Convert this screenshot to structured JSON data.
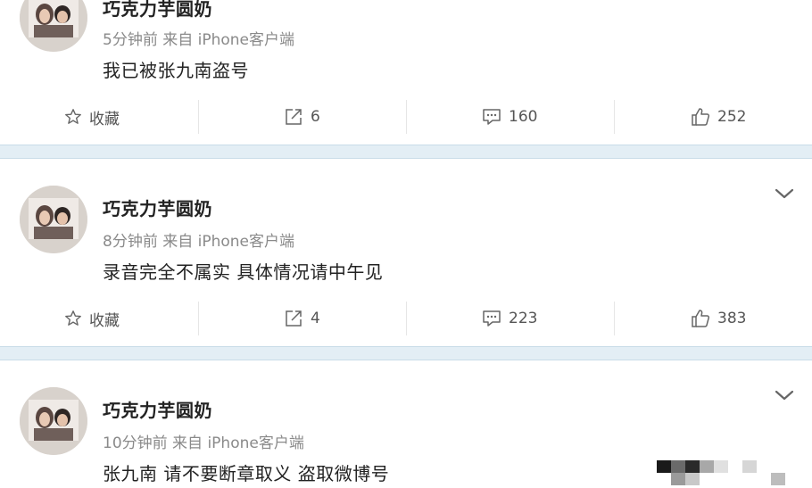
{
  "posts": [
    {
      "username": "巧克力芋圆奶",
      "meta": "5分钟前 来自 iPhone客户端",
      "content": "我已被张九南盗号",
      "actions": {
        "favorite_label": "收藏",
        "repost_count": "6",
        "comment_count": "160",
        "like_count": "252"
      }
    },
    {
      "username": "巧克力芋圆奶",
      "meta": "8分钟前 来自 iPhone客户端",
      "content": "录音完全不属实 具体情况请中午见",
      "actions": {
        "favorite_label": "收藏",
        "repost_count": "4",
        "comment_count": "223",
        "like_count": "383"
      }
    },
    {
      "username": "巧克力芋圆奶",
      "meta": "10分钟前 来自 iPhone客户端",
      "content": "张九南 请不要断章取义 盗取微博号"
    }
  ],
  "icons": {
    "favorite": "star-icon",
    "repost": "repost-icon",
    "comment": "comment-icon",
    "like": "thumbs-up-icon",
    "menu": "chevron-down-icon"
  },
  "colors": {
    "separator": "#e3eef5",
    "text_primary": "#222222",
    "text_secondary": "#8a8a8a"
  }
}
